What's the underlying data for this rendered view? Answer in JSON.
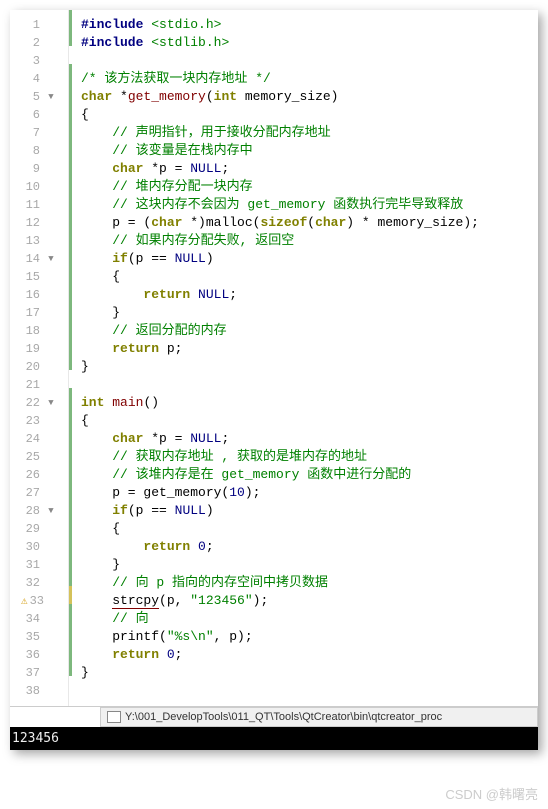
{
  "lines": [
    {
      "n": 1,
      "html": "<span class='pp'>#include</span> <span class='inc'>&lt;stdio.h&gt;</span>",
      "bar": "g"
    },
    {
      "n": 2,
      "html": "<span class='pp'>#include</span> <span class='inc'>&lt;stdlib.h&gt;</span>",
      "bar": "g"
    },
    {
      "n": 3,
      "html": "",
      "bar": ""
    },
    {
      "n": 4,
      "html": "<span class='cmt'>/* 该方法获取一块内存地址 */</span>",
      "bar": "g"
    },
    {
      "n": 5,
      "html": "<span class='kw'>char</span> *<span class='fn'>get_memory</span>(<span class='kw'>int</span> memory_size)",
      "fold": true,
      "bar": "g"
    },
    {
      "n": 6,
      "html": "{",
      "bar": "g"
    },
    {
      "n": 7,
      "html": "    <span class='cmt'>// 声明指针，用于接收分配内存地址</span>",
      "bar": "g"
    },
    {
      "n": 8,
      "html": "    <span class='cmt'>// 该变量是在栈内存中</span>",
      "bar": "g"
    },
    {
      "n": 9,
      "html": "    <span class='kw'>char</span> *p = <span class='num'>NULL</span>;",
      "bar": "g"
    },
    {
      "n": 10,
      "html": "    <span class='cmt'>// 堆内存分配一块内存</span>",
      "bar": "g"
    },
    {
      "n": 11,
      "html": "    <span class='cmt'>// 这块内存不会因为 get_memory 函数执行完毕导致释放</span>",
      "bar": "g"
    },
    {
      "n": 12,
      "html": "    p = (<span class='kw'>char</span> *)malloc(<span class='kw'>sizeof</span>(<span class='kw'>char</span>) * memory_size);",
      "bar": "g"
    },
    {
      "n": 13,
      "html": "    <span class='cmt'>// 如果内存分配失败, 返回空</span>",
      "bar": "g"
    },
    {
      "n": 14,
      "html": "    <span class='kw'>if</span>(p == <span class='num'>NULL</span>)",
      "fold": true,
      "bar": "g"
    },
    {
      "n": 15,
      "html": "    {",
      "bar": "g"
    },
    {
      "n": 16,
      "html": "        <span class='kw'>return</span> <span class='num'>NULL</span>;",
      "bar": "g"
    },
    {
      "n": 17,
      "html": "    }",
      "bar": "g"
    },
    {
      "n": 18,
      "html": "    <span class='cmt'>// 返回分配的内存</span>",
      "bar": "g"
    },
    {
      "n": 19,
      "html": "    <span class='kw'>return</span> p;",
      "bar": "g"
    },
    {
      "n": 20,
      "html": "}",
      "bar": "g"
    },
    {
      "n": 21,
      "html": "",
      "bar": ""
    },
    {
      "n": 22,
      "html": "<span class='kw'>int</span> <span class='fn'>main</span>()",
      "fold": true,
      "bar": "g"
    },
    {
      "n": 23,
      "html": "{",
      "bar": "g"
    },
    {
      "n": 24,
      "html": "    <span class='kw'>char</span> *p = <span class='num'>NULL</span>;",
      "bar": "g"
    },
    {
      "n": 25,
      "html": "    <span class='cmt'>// 获取内存地址 , 获取的是堆内存的地址</span>",
      "bar": "g"
    },
    {
      "n": 26,
      "html": "    <span class='cmt'>// 该堆内存是在 get_memory 函数中进行分配的</span>",
      "bar": "g"
    },
    {
      "n": 27,
      "html": "    p = get_memory(<span class='num'>10</span>);",
      "bar": "g"
    },
    {
      "n": 28,
      "html": "    <span class='kw'>if</span>(p == <span class='num'>NULL</span>)",
      "fold": true,
      "bar": "g"
    },
    {
      "n": 29,
      "html": "    {",
      "bar": "g"
    },
    {
      "n": 30,
      "html": "        <span class='kw'>return</span> <span class='num'>0</span>;",
      "bar": "g"
    },
    {
      "n": 31,
      "html": "    }",
      "bar": "g"
    },
    {
      "n": 32,
      "html": "    <span class='cmt'>// 向 p 指向的内存空间中拷贝数据</span>",
      "bar": "g"
    },
    {
      "n": 33,
      "html": "    <span class='underline' style='color:#000'>strcpy</span>(p, <span class='str'>\"123456\"</span>);",
      "warn": true,
      "bar": "y"
    },
    {
      "n": 34,
      "html": "    <span class='cmt'>// 向</span>",
      "bar": "g"
    },
    {
      "n": 35,
      "html": "    printf(<span class='str'>\"%s\\n\"</span>, p);",
      "bar": "g"
    },
    {
      "n": 36,
      "html": "    <span class='kw'>return</span> <span class='num'>0</span>;",
      "bar": "g"
    },
    {
      "n": 37,
      "html": "}",
      "bar": "g"
    },
    {
      "n": 38,
      "html": "",
      "bar": ""
    }
  ],
  "filepath": "Y:\\001_DevelopTools\\011_QT\\Tools\\QtCreator\\bin\\qtcreator_proc",
  "console_output": "123456",
  "watermark": "CSDN @韩曙亮"
}
